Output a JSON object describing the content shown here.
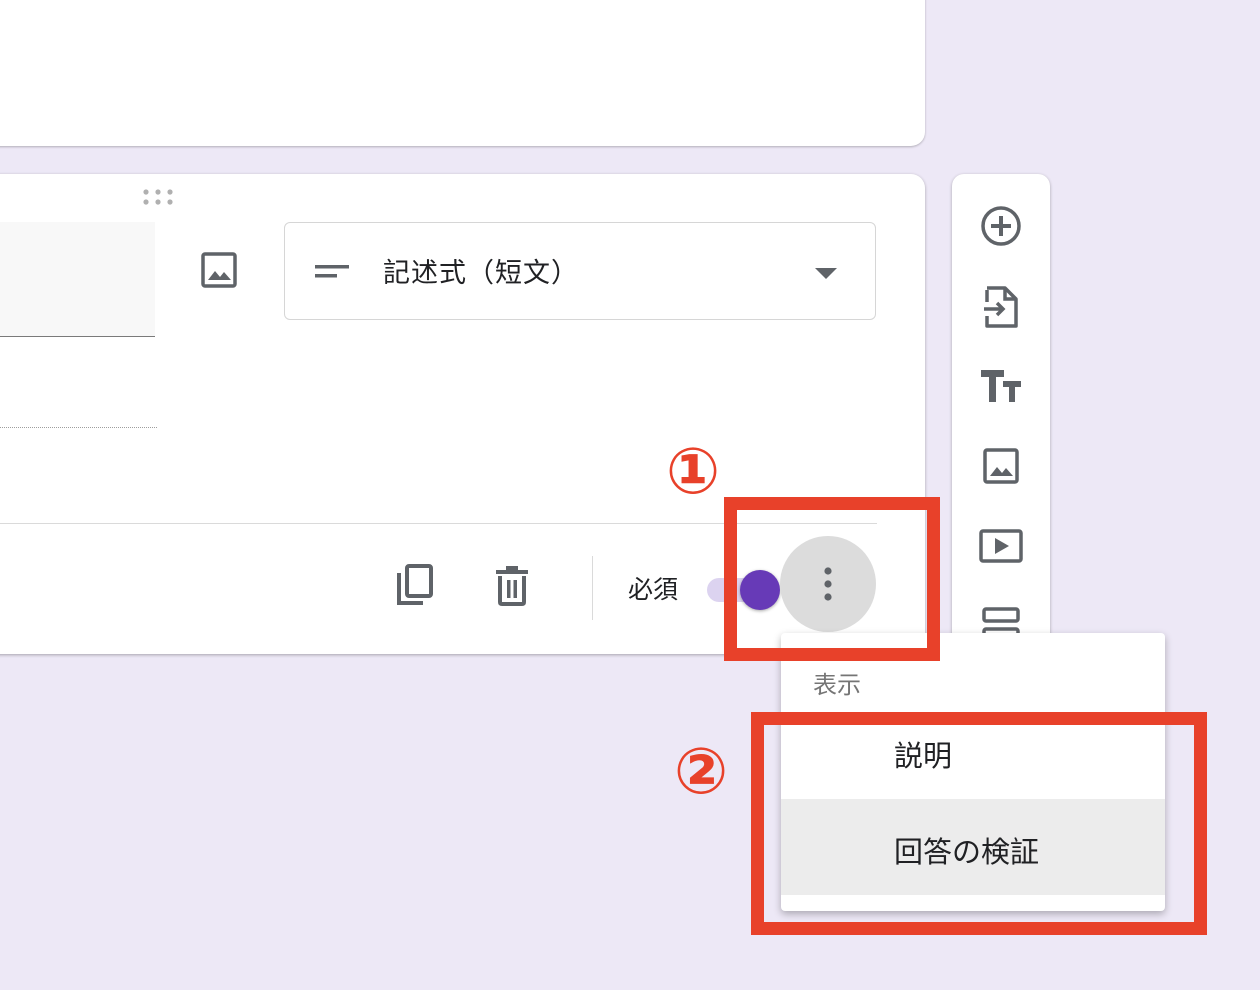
{
  "question": {
    "type_select": {
      "label": "記述式（短文）",
      "icon": "short-answer-lines-icon"
    },
    "required_label": "必須",
    "required_on": true
  },
  "sidebar": {
    "tools": [
      "add-question-icon",
      "import-questions-icon",
      "add-title-icon",
      "add-image-icon",
      "add-video-icon",
      "add-section-icon"
    ]
  },
  "menu": {
    "section_header": "表示",
    "items": [
      "説明",
      "回答の検証"
    ]
  },
  "annotations": {
    "marker1": "①",
    "marker2": "②",
    "color": "#e8412a"
  },
  "colors": {
    "accent": "#673ab7",
    "background": "#ede8f6"
  }
}
